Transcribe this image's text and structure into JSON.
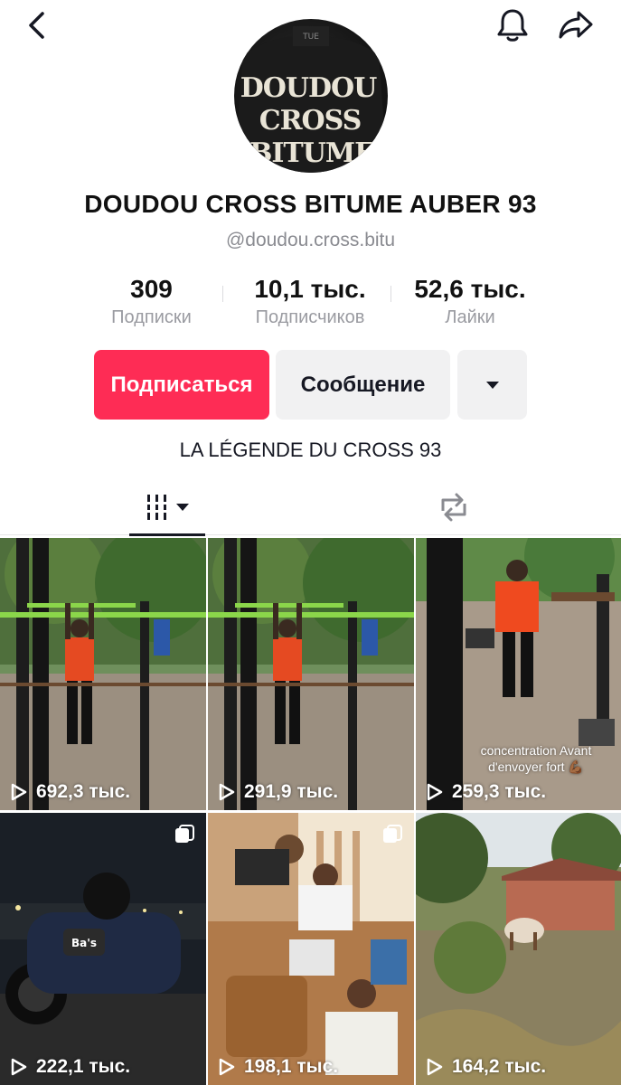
{
  "profile": {
    "name": "DOUDOU CROSS BITUME AUBER 93",
    "handle": "@doudou.cross.bitu",
    "avatar_text": "DOUDOU CROSS BITUME",
    "bio": "LA LÉGENDE DU CROSS 93"
  },
  "stats": [
    {
      "value": "309",
      "label": "Подписки"
    },
    {
      "value": "10,1 тыс.",
      "label": "Подписчиков"
    },
    {
      "value": "52,6 тыс.",
      "label": "Лайки"
    }
  ],
  "actions": {
    "follow_label": "Подписаться",
    "message_label": "Сообщение",
    "more_icon": "caret-down-icon"
  },
  "tabs": [
    {
      "name": "videos",
      "icon": "grid-bars-icon",
      "active": true
    },
    {
      "name": "reposts",
      "icon": "repost-icon",
      "active": false
    }
  ],
  "videos": [
    {
      "views": "692,3 тыс.",
      "caption": "",
      "multi": false
    },
    {
      "views": "291,9 тыс.",
      "caption": "",
      "multi": false
    },
    {
      "views": "259,3 тыс.",
      "caption": "concentration Avant d'envoyer fort 💪🏾",
      "multi": false
    },
    {
      "views": "222,1 тыс.",
      "caption": "",
      "multi": true
    },
    {
      "views": "198,1 тыс.",
      "caption": "",
      "multi": true
    },
    {
      "views": "164,2 тыс.",
      "caption": "",
      "multi": false
    }
  ],
  "colors": {
    "accent": "#fe2c55",
    "text": "#161823",
    "muted": "#8a8b91"
  }
}
